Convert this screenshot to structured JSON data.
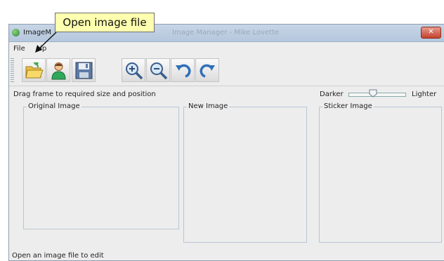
{
  "window": {
    "title": "ImageM",
    "blurred_title": "Image Manager - Mike Lovette"
  },
  "menu": {
    "file": "File",
    "help": "Help",
    "help_visible": "elp"
  },
  "toolbar": {
    "buttons": [
      {
        "name": "open-folder-icon"
      },
      {
        "name": "user-icon"
      },
      {
        "name": "save-icon"
      },
      {
        "name": "zoom-in-icon"
      },
      {
        "name": "zoom-out-icon"
      },
      {
        "name": "rotate-left-icon"
      },
      {
        "name": "rotate-right-icon"
      }
    ]
  },
  "hint": "Drag frame to required size and position",
  "contrast": {
    "darker": "Darker",
    "lighter": "Lighter",
    "value": 0.45
  },
  "panels": {
    "original": "Original Image",
    "new": "New Image",
    "sticker": "Sticker Image"
  },
  "status": "Open an image file to edit",
  "callout": "Open image file",
  "colors": {
    "callout_bg": "#ffffb0",
    "titlebar": "#c7d5e6",
    "close": "#c4422d"
  }
}
